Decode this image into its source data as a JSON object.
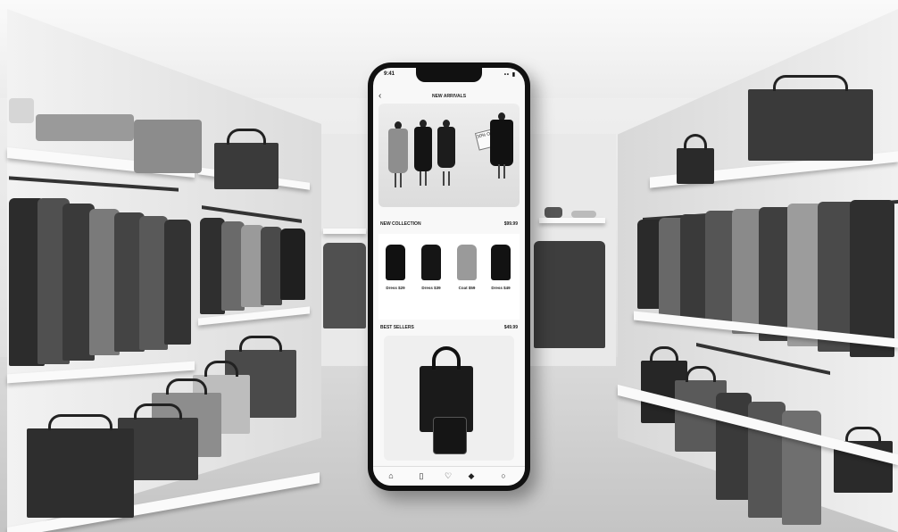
{
  "app": {
    "status_time": "9:41",
    "status_icons": "•• ▮",
    "back_glyph": "‹",
    "screen_title": "NEW ARRIVALS"
  },
  "banner": {
    "badge_text": "30% OFF"
  },
  "sections": [
    {
      "label": "NEW COLLECTION",
      "price": "$99.99"
    },
    {
      "label": "BEST SELLERS",
      "price": "$49.99"
    }
  ],
  "products": [
    {
      "label": "Dress $29",
      "color": "#111111"
    },
    {
      "label": "Dress $39",
      "color": "#151515"
    },
    {
      "label": "Coat $59",
      "color": "#9a9a9a"
    },
    {
      "label": "Dress $49",
      "color": "#121212"
    }
  ],
  "tabs": [
    {
      "icon": "home-icon",
      "glyph": "⌂"
    },
    {
      "icon": "bag-icon",
      "glyph": "▯"
    },
    {
      "icon": "heart-icon",
      "glyph": "♡"
    },
    {
      "icon": "tag-icon",
      "glyph": "◆"
    },
    {
      "icon": "profile-icon",
      "glyph": "○"
    }
  ],
  "colors": {
    "phone_frame": "#111111",
    "screen_bg": "#f8f8f8",
    "shelf": "#fafafa",
    "garment_dark": "#2a2a2a",
    "garment_mid": "#6e6e6e"
  }
}
